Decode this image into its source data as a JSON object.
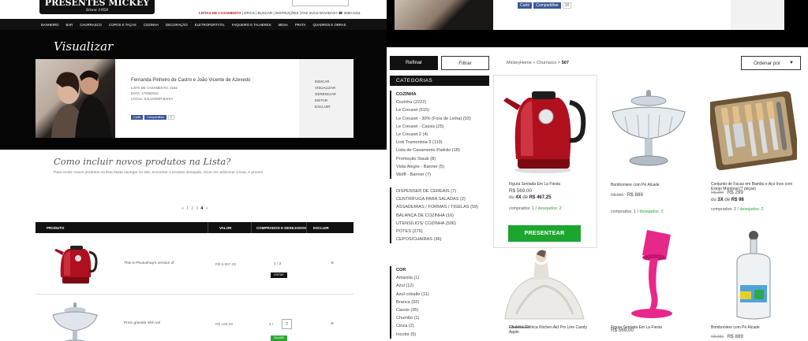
{
  "left_screen": {
    "logo": {
      "text": "PRESENTES MICKEY",
      "since": "Since 1958"
    },
    "top_links": {
      "highlight": "LISTAS DE CASAMENTO",
      "rest": "| OFICS | BUSCAR | INSTRUÇÕES | FAZ SUAS DÚVIDAS? ☎ 3060-2411"
    },
    "nav": [
      "BANHEIRO",
      "BAR",
      "CHURRASCO",
      "COPOS E TAÇAS",
      "COZINHA",
      "DECORAÇÃO",
      "ELETROPORTÁTIL",
      "FAQUEIRO E TALHERES",
      "MESA",
      "PRATA",
      "QUADROS E OBRAS"
    ],
    "page_title": "Visualizar",
    "list": {
      "names": "Fernanda Pinheiro de Castro e João Vicente de Azevedo",
      "code": "LISTA DE CASAMENTO: 2152",
      "date": "DATA: 17/09/2015",
      "place": "LOCAL: SALVADOR BAHIA",
      "share_like": "Curtir",
      "share_btn": "Compartilhar",
      "share_count": "0"
    },
    "side_menu": [
      "INDICAR",
      "VISUALIZAR",
      "GERENCIAR",
      "EDITAR",
      "EXCLUIR"
    ],
    "howto_title": "Como incluir novos produtos na Lista?",
    "howto_text": "Para incluir novos produtos na lista basta navegar no site, encontrar o produto desejado, clicar em adicionar à lista, e pronto!",
    "pagination": {
      "prev": "«",
      "pages": [
        "1",
        "2",
        "3"
      ],
      "current": "4",
      "next": "»"
    },
    "table": {
      "headers": [
        "PRODUTO",
        "VALOR",
        "COMPRADOS E DESEJADOS",
        "EXCLUIR"
      ],
      "rows": [
        {
          "name": "This is Photoshop's version  of",
          "value": "R$ 6,997.00",
          "qty": "1 / 2",
          "action": "EDITAR",
          "remove": "×"
        },
        {
          "name": "Proin gravida nibh vel",
          "value": "R$ 159,00",
          "qty": "1 /",
          "qty_box": "2",
          "action": "SALVAR",
          "remove": "×"
        }
      ]
    }
  },
  "right_screen": {
    "share_like": "Curtir",
    "share_btn": "Compartilhar",
    "share_count": "10",
    "refine_button": "Refinar",
    "filter_button": "Filtrar",
    "breadcrumb": {
      "path": "MickeyHome  >  Churrasco  >",
      "current": "507"
    },
    "sort_button": "Ordenar por",
    "categories_title": "CATEGORIAS",
    "kitchen": {
      "heading": "COZINHA",
      "items": [
        "Cozinha (2222)",
        "Le Creuset (515)",
        "Le Creuset - 30% (Fora de Linha) (93)",
        "Le Creuset - Cassis (25)",
        "Le Creuset 2 (4)",
        "Link Tramontina 2 (119)",
        "Lista de Casamento Padrão (18)",
        "Promoção Staub (8)",
        "Vista Alegre - Banner (5)",
        "Wolff - Banner (7)"
      ]
    },
    "other_cats": [
      "DISPENSER DE CEREAIS (7)",
      "CENTRÍFUGA PARA SALADAS (2)",
      "ASSADEIRAS / FORMAS / TIGELAS (59)",
      "BALANÇA DE COZINHA (16)",
      "UTENSÍLIOS/ COZINHA (506)",
      "POTES (276)",
      "CEPOS/CHAIRAS (36)"
    ],
    "color": {
      "heading": "COR",
      "items": [
        "Amarela (1)",
        "Azul (12)",
        "Azul cobalto (11)",
        "Branca (92)",
        "Cassis (26)",
        "Chumbo (1)",
        "Cinza (2)",
        "Incolor (5)"
      ]
    },
    "products": [
      {
        "name": "Figura Sentada Em La Fiesta",
        "price": "R$ 569,00",
        "inst_prefix": "ou",
        "inst_count": "4X",
        "inst_mid": "de",
        "inst_value": "R$ 467,25",
        "bought_label": "comprados: 1",
        "wanted_label": "desejados:  2",
        "cta": "PRESENTEAR"
      },
      {
        "name": "Bomboniere com Pé Alcade",
        "old": "R$ 980",
        "price": "R$ 889",
        "bought_label": "comprados: 1",
        "wanted_label": "desejados:  2"
      },
      {
        "name": "Conjunto de Facas em Bambu e Aço Inox com Estojo Montreal (7 peças)",
        "old": "R$ 350",
        "price": "R$ 299",
        "inst_prefix": "ou",
        "inst_count": "3X",
        "inst_mid": "de",
        "inst_value": "R$ 98",
        "bought_label": "comprados: 2",
        "wanted_label": "desejados:  2"
      },
      {
        "name": "Chaleira Elétrica Kitchen Aid Pro Line Candy Apple",
        "old": "R$ 1000,00"
      },
      {
        "name": "Figura Sentada Em La Fiesta",
        "price": "R$ 569,00"
      },
      {
        "name": "Bomboniere com Pé Alcade",
        "old": "R$ 980",
        "price": "R$ 889"
      }
    ]
  },
  "colors": {
    "accent_red": "#c0141c",
    "green": "#1ca52f",
    "black": "#111111",
    "kettle_red": "#b0101e",
    "pink": "#e8278a"
  }
}
